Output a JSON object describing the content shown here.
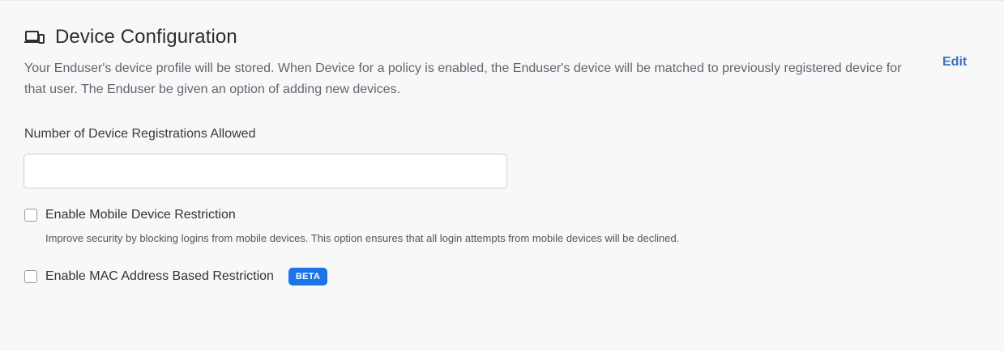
{
  "section": {
    "icon": "devices-icon",
    "title": "Device Configuration",
    "edit_label": "Edit",
    "description": "Your Enduser's device profile will be stored. When Device for a policy is enabled, the Enduser's device will be matched to previously registered device for that user. The Enduser be given an option of adding new devices."
  },
  "registrations": {
    "label": "Number of Device Registrations Allowed",
    "value": "",
    "placeholder": ""
  },
  "mobile_restriction": {
    "label": "Enable Mobile Device Restriction",
    "checked": false,
    "hint": "Improve security by blocking logins from mobile devices. This option ensures that all login attempts from mobile devices will be declined."
  },
  "mac_restriction": {
    "label": "Enable MAC Address Based Restriction",
    "checked": false,
    "badge": "BETA"
  },
  "colors": {
    "accent": "#3b73b9",
    "badge_bg": "#1b74e8",
    "background": "#f8f8f8"
  }
}
